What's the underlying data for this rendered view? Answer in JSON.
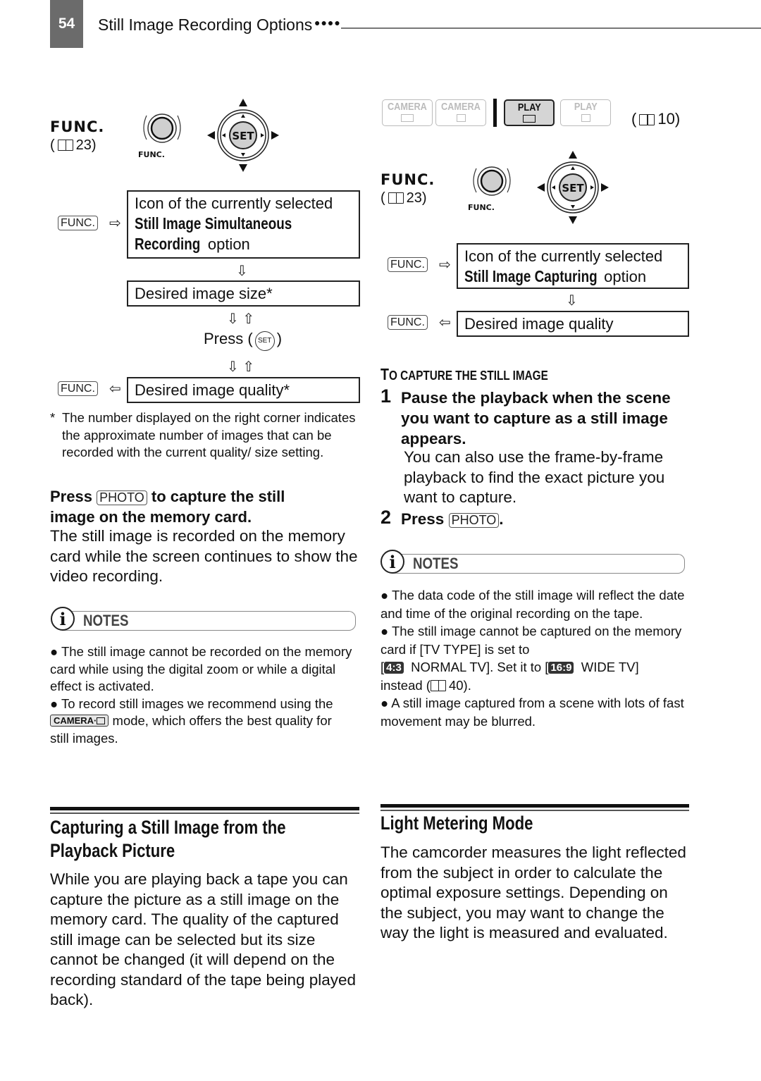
{
  "header": {
    "page_number": "54",
    "title": "Still Image Recording Options",
    "dots": "●●●●"
  },
  "left": {
    "func_label": "FUNC.",
    "func_ref": "23",
    "knob_label": "FUNC.",
    "joystick_center": "SET",
    "flow": {
      "box1_line1": "Icon of the currently selected",
      "box1_line2_bold": "Still Image Simultaneous",
      "box1_line3_bold": "Recording",
      "box1_line3_rest": " option",
      "box2": "Desired image size*",
      "press_label": "Press (",
      "press_close": ")",
      "set_label": "SET",
      "box3": "Desired image quality*",
      "func_key": "FUNC.",
      "arrow_right": "⇨",
      "arrow_left": "⇦",
      "arrow_down": "⇩",
      "arrow_updown": "⇩ ⇧"
    },
    "footnote_star": "*",
    "footnote": "The number displayed on the right corner indicates the approximate number of images that can be recorded with the current quality/ size setting.",
    "instruction_pre": "Press",
    "instruction_key": "PHOTO",
    "instruction_post": "to capture the still",
    "instruction_line2": "image on the memory card.",
    "instruction_body": "The still image is recorded on the memory card while the screen continues to show the video recording.",
    "notes_title": "NOTES",
    "notes": [
      "The still image cannot be recorded on the memory card while using the digital zoom or while a digital effect is activated.",
      {
        "pre": "To record still images we recommend using the",
        "badge": "CAMERA·",
        "post": "mode, which offers the best quality for still images."
      }
    ]
  },
  "right": {
    "modes": [
      {
        "label": "CAMERA",
        "icon": "tape-icon",
        "active": false
      },
      {
        "label": "CAMERA",
        "icon": "card-icon",
        "active": false
      },
      {
        "label": "PLAY",
        "icon": "tape-icon",
        "active": true
      },
      {
        "label": "PLAY",
        "icon": "card-icon",
        "active": false
      }
    ],
    "mode_ref": "10",
    "func_label": "FUNC.",
    "func_ref": "23",
    "knob_label": "FUNC.",
    "joystick_center": "SET",
    "flow": {
      "box1_line1": "Icon of the currently selected",
      "box1_line2_bold": "Still Image Capturing",
      "box1_line2_rest": " option",
      "box2": "Desired image quality",
      "func_key": "FUNC.",
      "arrow_right": "⇨",
      "arrow_left": "⇦",
      "arrow_down": "⇩"
    },
    "procedure_title_T": "T",
    "procedure_title_rest": "O CAPTURE THE STILL IMAGE",
    "steps": [
      {
        "num": "1",
        "bold": "Pause the playback when the scene you want to capture as a still image appears.",
        "body": "You can also use the frame-by-frame playback to find the exact picture you want to capture."
      },
      {
        "num": "2",
        "bold": "Press",
        "key": "PHOTO",
        "after": "."
      }
    ],
    "notes_title": "NOTES",
    "notes": [
      "The data code of the still image will reflect the date and time of the original recording on the tape.",
      {
        "line1": "The still image cannot be captured on the memory card if [TV TYPE] is set to",
        "open": "[",
        "badge1": "4:3",
        "mid": "NORMAL TV]. Set it to [",
        "badge2": "16:9",
        "end": "WIDE TV]",
        "tail_pre": "instead (",
        "tail_ref": "40",
        "tail_post": ")."
      },
      "A still image captured from a scene with lots of fast movement may be blurred."
    ]
  },
  "section_left": {
    "title_line1": "Capturing a Still Image from the",
    "title_line2": "Playback Picture",
    "body": "While you are playing back a tape you can capture the picture as a still image on the memory card. The quality of the captured still image can be selected but its size cannot be changed (it will depend on the recording standard of the tape being played back)."
  },
  "section_right": {
    "title": "Light Metering Mode",
    "body": "The camcorder measures the light reflected from the subject in order to calculate the optimal exposure settings. Depending on the subject, you may want to change the way the light is measured and evaluated."
  }
}
